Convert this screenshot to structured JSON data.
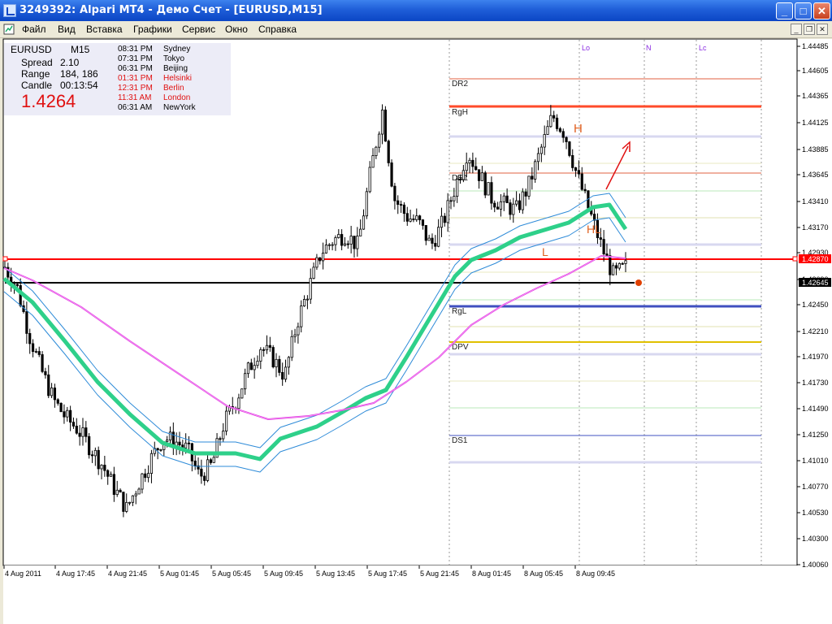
{
  "window": {
    "title": "3249392: Alpari MT4 - Демо Счет - [EURUSD,M15]",
    "min_glyph": "_",
    "max_glyph": "□",
    "close_glyph": "✕"
  },
  "menu": {
    "items": [
      "Файл",
      "Вид",
      "Вставка",
      "Графики",
      "Сервис",
      "Окно",
      "Справка"
    ],
    "mdi_min": "_",
    "mdi_restore": "❐",
    "mdi_close": "✕"
  },
  "panel": {
    "symbol": "EURUSD",
    "timeframe": "M15",
    "spread_label": "Spread",
    "spread": "2.10",
    "range_label": "Range",
    "range": "184, 186",
    "candle_label": "Candle",
    "candle": "00:13:54",
    "price": "1.4264",
    "sessions": [
      {
        "time": "08:31 PM",
        "city": "Sydney",
        "color": "#000000"
      },
      {
        "time": "07:31 PM",
        "city": "Tokyo",
        "color": "#000000"
      },
      {
        "time": "06:31 PM",
        "city": "Beijing",
        "color": "#000000"
      },
      {
        "time": "01:31 PM",
        "city": "Helsinki",
        "color": "#e01010"
      },
      {
        "time": "12:31 PM",
        "city": "Berlin",
        "color": "#e01010"
      },
      {
        "time": "11:31 AM",
        "city": "London",
        "color": "#e01010"
      },
      {
        "time": "06:31 AM",
        "city": "NewYork",
        "color": "#000000"
      }
    ]
  },
  "chart_data": {
    "type": "candlestick",
    "symbol": "EURUSD",
    "timeframe": "M15",
    "y_ticks": [
      "1.44485",
      "1.44605",
      "1.44365",
      "1.44125",
      "1.43885",
      "1.43645",
      "1.43410",
      "1.43170",
      "1.42930",
      "1.42690",
      "1.42450",
      "1.42210",
      "1.41970",
      "1.41730",
      "1.41490",
      "1.41250",
      "1.41010",
      "1.40770",
      "1.40530",
      "1.40300",
      "1.40060"
    ],
    "x_ticks": [
      "4 Aug 2011",
      "4 Aug 17:45",
      "4 Aug 21:45",
      "5 Aug 01:45",
      "5 Aug 05:45",
      "5 Aug 09:45",
      "5 Aug 13:45",
      "5 Aug 17:45",
      "5 Aug 21:45",
      "8 Aug 01:45",
      "8 Aug 05:45",
      "8 Aug 09:45"
    ],
    "current_price_label": "1.42645",
    "level_price_label": "1.42870",
    "levels": [
      {
        "name": "DR2",
        "price": 1.4451,
        "color": "#e06040"
      },
      {
        "name": "RgH",
        "price": 1.4428,
        "color": "#ff4a2a"
      },
      {
        "name": "DR1",
        "price": 1.4366,
        "color": "#e06040"
      },
      {
        "name": "RgL",
        "price": 1.4244,
        "color": "#4050c0"
      },
      {
        "name": "DPV",
        "price": 1.4205,
        "color": "#e0c000"
      },
      {
        "name": "DS1",
        "price": 1.4125,
        "color": "#4050c0"
      }
    ],
    "session_labels": [
      "Lo",
      "N",
      "Lc"
    ],
    "pattern_labels": [
      "H",
      "L",
      "HL"
    ],
    "close_approx": [
      1.4262,
      1.4245,
      1.4205,
      1.4175,
      1.415,
      1.4135,
      1.4125,
      1.411,
      1.4095,
      1.4075,
      1.4058,
      1.408,
      1.41,
      1.4118,
      1.4115,
      1.4108,
      1.4085,
      1.4095,
      1.413,
      1.415,
      1.4175,
      1.4195,
      1.4185,
      1.417,
      1.4215,
      1.4245,
      1.4275,
      1.4285,
      1.429,
      1.428,
      1.434,
      1.4395,
      1.432,
      1.4305,
      1.43,
      1.428,
      1.43,
      1.433,
      1.436,
      1.434,
      1.432,
      1.4315,
      1.431,
      1.433,
      1.436,
      1.439,
      1.4375,
      1.434,
      1.431,
      1.428,
      1.4255,
      1.4262
    ]
  }
}
